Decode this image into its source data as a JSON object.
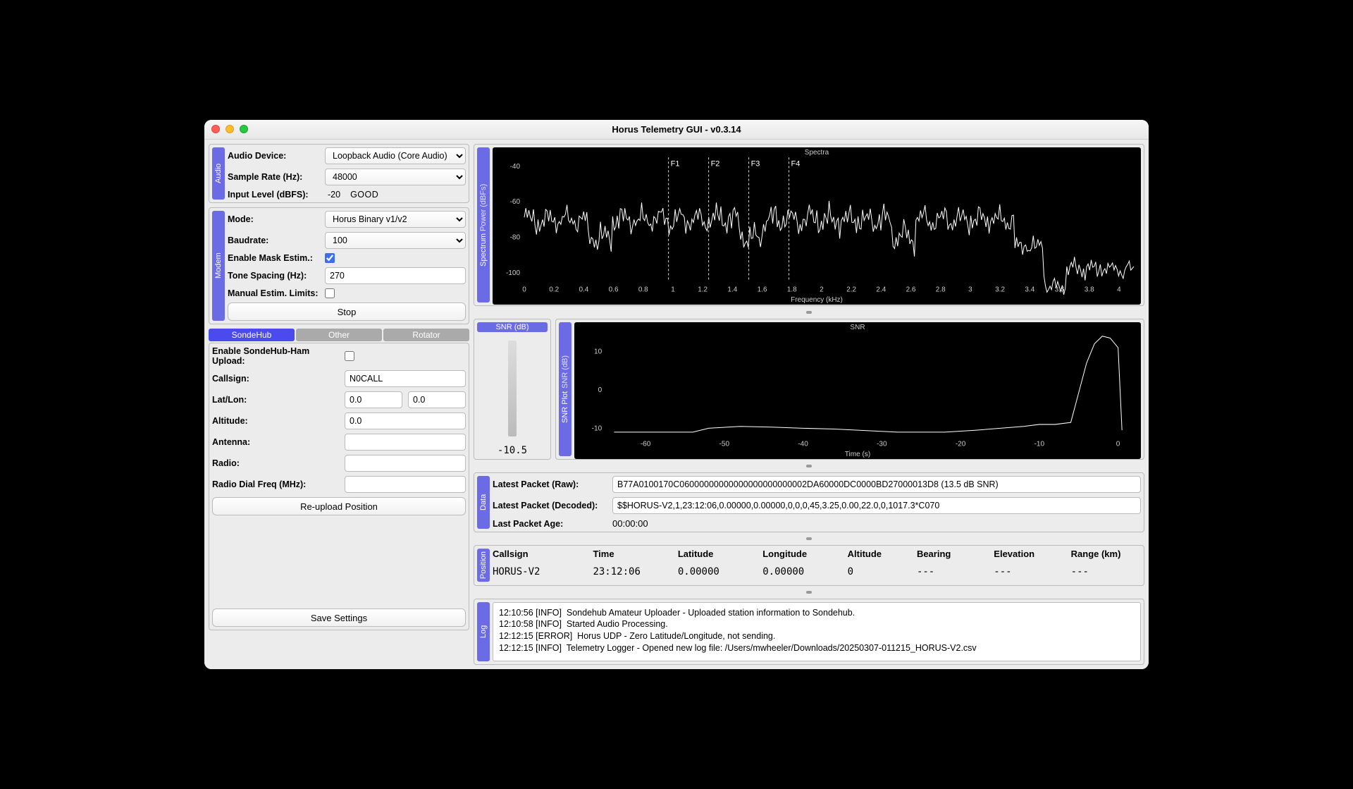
{
  "window": {
    "title": "Horus Telemetry GUI - v0.3.14"
  },
  "audio": {
    "section": "Audio",
    "device_label": "Audio Device:",
    "device_value": "Loopback Audio (Core Audio)",
    "samplerate_label": "Sample Rate (Hz):",
    "samplerate_value": "48000",
    "inputlevel_label": "Input Level (dBFS):",
    "inputlevel_value": "-20",
    "inputlevel_status": "GOOD"
  },
  "modem": {
    "section": "Modem",
    "mode_label": "Mode:",
    "mode_value": "Horus Binary v1/v2",
    "baud_label": "Baudrate:",
    "baud_value": "100",
    "mask_label": "Enable Mask Estim.:",
    "mask_checked": true,
    "tone_label": "Tone Spacing (Hz):",
    "tone_value": "270",
    "manual_label": "Manual Estim. Limits:",
    "manual_checked": false,
    "stop_label": "Stop"
  },
  "upload_tabs": {
    "t1": "SondeHub",
    "t2": "Other",
    "t3": "Rotator"
  },
  "sondehub": {
    "enable_label": "Enable SondeHub-Ham Upload:",
    "enable_checked": false,
    "callsign_label": "Callsign:",
    "callsign_value": "N0CALL",
    "latlon_label": "Lat/Lon:",
    "lat_value": "0.0",
    "lon_value": "0.0",
    "alt_label": "Altitude:",
    "alt_value": "0.0",
    "antenna_label": "Antenna:",
    "antenna_value": "",
    "radio_label": "Radio:",
    "radio_value": "",
    "dial_label": "Radio Dial Freq (MHz):",
    "dial_value": "",
    "reupload_label": "Re-upload Position",
    "save_label": "Save Settings"
  },
  "spectrum_panel": {
    "section": "Spectrum",
    "axis_y": "Power (dBFs)"
  },
  "snrplot_panel": {
    "section": "SNR Plot",
    "axis_y": "SNR (dB)"
  },
  "snr_gauge": {
    "title": "SNR (dB)",
    "value": "-10.5"
  },
  "data": {
    "section": "Data",
    "raw_label": "Latest Packet (Raw):",
    "raw_value": "B77A0100170C06000000000000000000000002DA60000DC0000BD27000013D8 (13.5 dB SNR)",
    "dec_label": "Latest Packet (Decoded):",
    "dec_value": "$$HORUS-V2,1,23:12:06,0.00000,0.00000,0,0,0,45,3.25,0.00,22.0,0,1017.3*C070",
    "age_label": "Last Packet Age:",
    "age_value": "00:00:00"
  },
  "position": {
    "section": "Position",
    "h_callsign": "Callsign",
    "h_time": "Time",
    "h_lat": "Latitude",
    "h_lon": "Longitude",
    "h_alt": "Altitude",
    "h_bearing": "Bearing",
    "h_elev": "Elevation",
    "h_range": "Range (km)",
    "v_callsign": "HORUS-V2",
    "v_time": "23:12:06",
    "v_lat": "0.00000",
    "v_lon": "0.00000",
    "v_alt": "0",
    "v_bearing": "---",
    "v_elev": "---",
    "v_range": "---"
  },
  "log": {
    "section": "Log",
    "lines": "12:10:56 [INFO]  Sondehub Amateur Uploader - Uploaded station information to Sondehub.\n12:10:58 [INFO]  Started Audio Processing.\n12:12:15 [ERROR]  Horus UDP - Zero Latitude/Longitude, not sending.\n12:12:15 [INFO]  Telemetry Logger - Opened new log file: /Users/mwheeler/Downloads/20250307-011215_HORUS-V2.csv"
  },
  "chart_data": [
    {
      "type": "line",
      "title": "Spectra",
      "xlabel": "Frequency (kHz)",
      "ylabel": "Power (dBFs)",
      "xlim": [
        0,
        4.1
      ],
      "ylim": [
        -105,
        -35
      ],
      "xticks": [
        0,
        0.2,
        0.4,
        0.6,
        0.8,
        1,
        1.2,
        1.4,
        1.6,
        1.8,
        2,
        2.2,
        2.4,
        2.6,
        2.8,
        3,
        3.2,
        3.4,
        3.6,
        3.8,
        4
      ],
      "yticks": [
        -40,
        -60,
        -80,
        -100
      ],
      "markers": [
        {
          "name": "F1",
          "x": 0.97
        },
        {
          "name": "F2",
          "x": 1.24
        },
        {
          "name": "F3",
          "x": 1.51
        },
        {
          "name": "F4",
          "x": 1.78
        }
      ],
      "series": [
        {
          "name": "spectrum",
          "baseline": -70,
          "noise_amplitude_db": 8,
          "segments": [
            {
              "x_from": 0.0,
              "x_to": 3.3,
              "mean_db": -70,
              "note": "noisy floor"
            },
            {
              "x_from": 3.3,
              "x_to": 3.5,
              "mean_db": -85,
              "note": "rolloff"
            },
            {
              "x_from": 3.5,
              "x_to": 4.1,
              "mean_db": -98,
              "note": "dropoff"
            }
          ]
        }
      ]
    },
    {
      "type": "line",
      "title": "SNR",
      "xlabel": "Time (s)",
      "ylabel": "SNR (dB)",
      "xlim": [
        -65,
        2
      ],
      "ylim": [
        -12,
        15
      ],
      "xticks": [
        -60,
        -50,
        -40,
        -30,
        -20,
        -10,
        0
      ],
      "yticks": [
        -10,
        0,
        10
      ],
      "series": [
        {
          "name": "snr",
          "x": [
            -64,
            -54,
            -52,
            -48,
            -44,
            -40,
            -36,
            -28,
            -22,
            -18,
            -12,
            -10,
            -8,
            -6,
            -4,
            -3,
            -2,
            -1,
            0,
            0.5
          ],
          "values": [
            -11,
            -11,
            -10,
            -9.5,
            -9.7,
            -10,
            -10.2,
            -11,
            -11,
            -10.5,
            -9.5,
            -9,
            -9,
            -8.5,
            7,
            12,
            14,
            13.5,
            11,
            -10.5
          ]
        }
      ]
    }
  ]
}
